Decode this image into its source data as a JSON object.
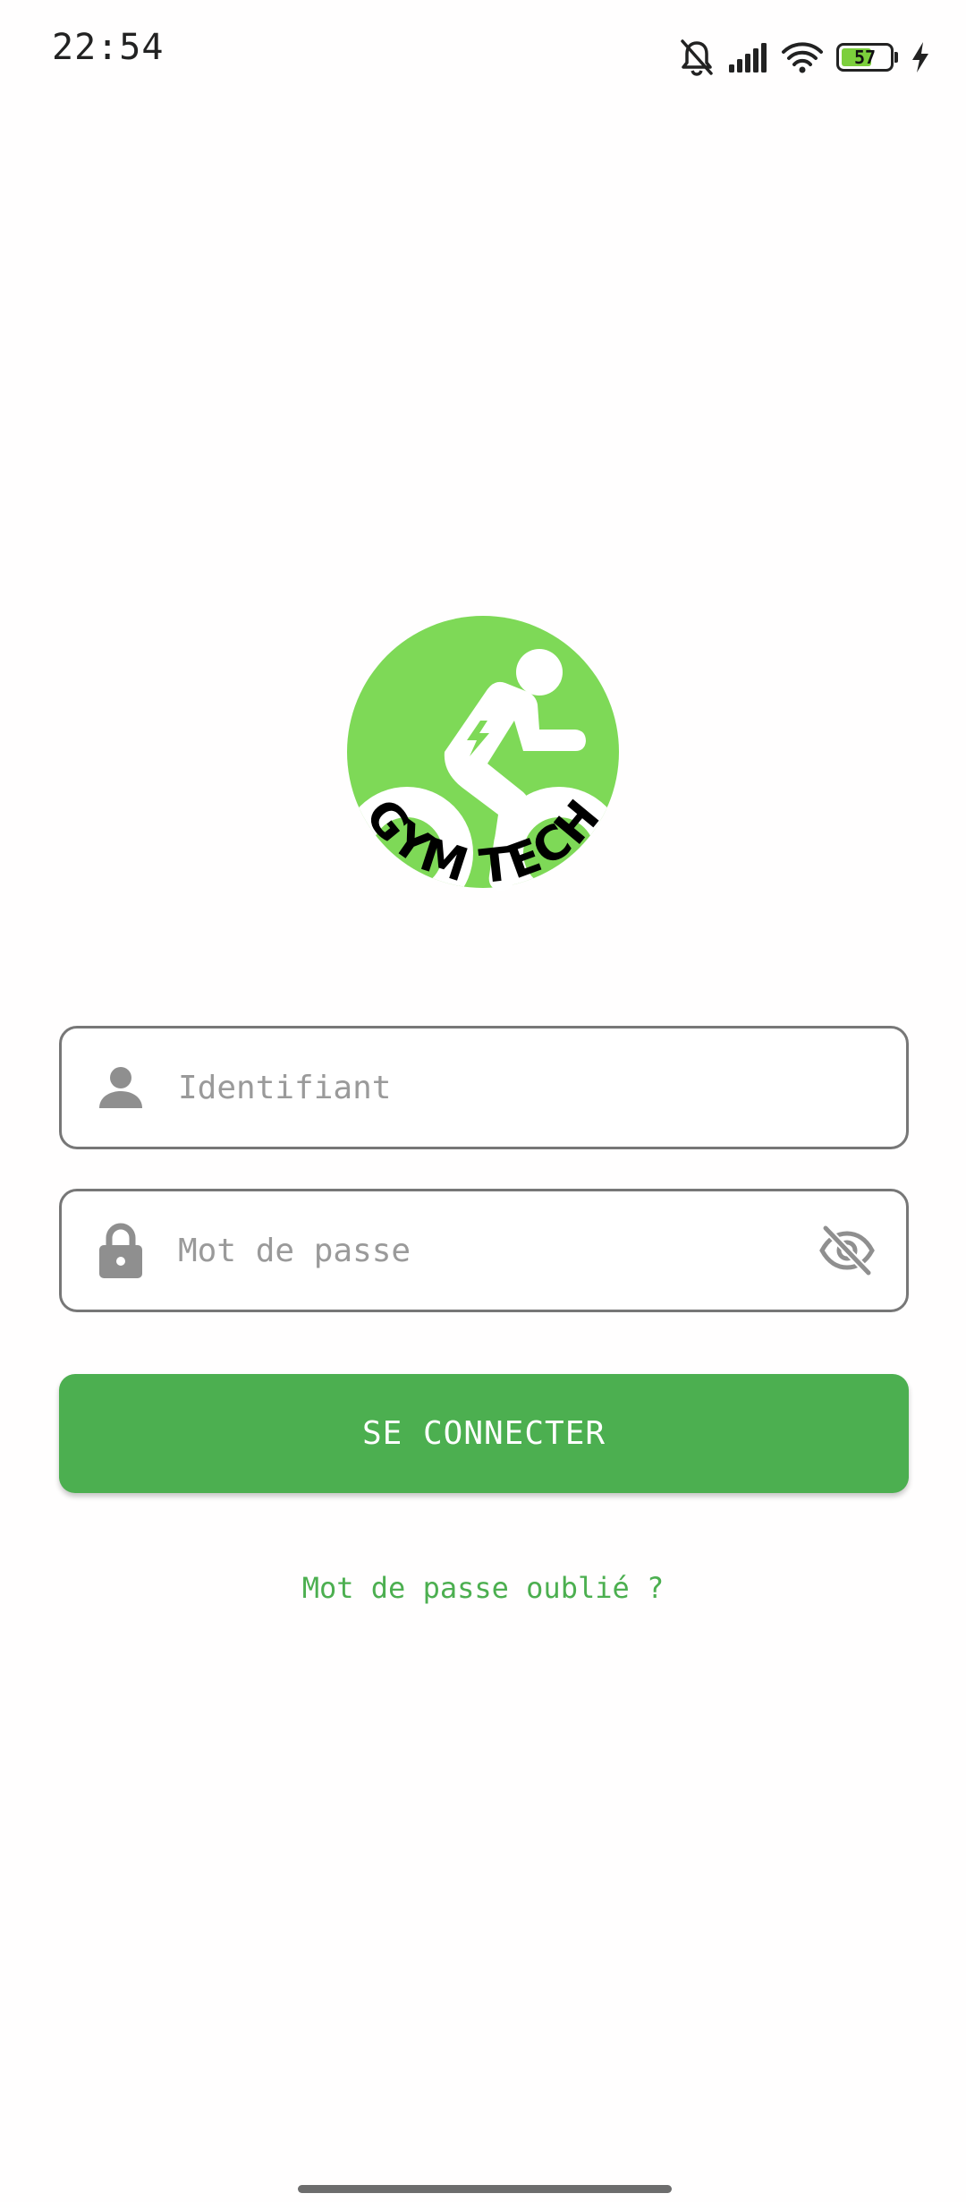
{
  "status_bar": {
    "time": "22:54",
    "battery_level": "57",
    "icons": [
      "bell-off-icon",
      "signal-icon",
      "wifi-icon",
      "battery-icon",
      "charging-icon"
    ]
  },
  "logo": {
    "text": "GYM TECH",
    "color": "#7ed957"
  },
  "form": {
    "username_placeholder": "Identifiant",
    "username_value": "",
    "password_placeholder": "Mot de passe",
    "password_value": "",
    "username_icon": "person-icon",
    "password_icon": "lock-icon",
    "visibility_icon": "eye-off-icon"
  },
  "actions": {
    "login_label": "SE CONNECTER",
    "forgot_password_label": "Mot de passe oublié ?"
  },
  "colors": {
    "accent": "#4caf50",
    "logo_green": "#7ed957",
    "field_icon": "#8f8f8f"
  }
}
